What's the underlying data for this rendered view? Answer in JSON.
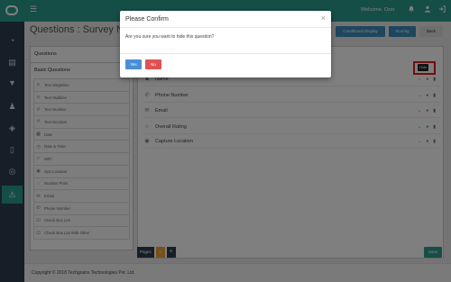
{
  "header": {
    "welcome": "Welcome, Ozer",
    "menu_icon": "☰",
    "icons": [
      "bell-icon",
      "user-icon",
      "logout-icon"
    ]
  },
  "sidebar": {
    "icons": [
      {
        "name": "dashboard-icon",
        "glyph": "◔"
      },
      {
        "name": "book-icon",
        "glyph": "▤"
      },
      {
        "name": "filter-icon",
        "glyph": "▼"
      },
      {
        "name": "users-icon",
        "glyph": "♟"
      },
      {
        "name": "layers-icon",
        "glyph": "◈"
      },
      {
        "name": "mobile-icon",
        "glyph": "▯"
      },
      {
        "name": "support-icon",
        "glyph": "◎"
      },
      {
        "name": "warning-icon",
        "glyph": "⚠",
        "active": true
      }
    ]
  },
  "page": {
    "title": "Questions : Survey Name",
    "buttons": {
      "conditional_display": "Conditional Display",
      "scoring": "Scoring",
      "back": "Back"
    }
  },
  "left_panel": {
    "tab": "Questions",
    "section_title": "Basic Questions",
    "items": [
      {
        "label": "Text Singleline",
        "icon": "≡"
      },
      {
        "label": "Text Multiline",
        "icon": "≡"
      },
      {
        "label": "Text Number",
        "icon": "#"
      },
      {
        "label": "Text Decimal",
        "icon": "#"
      },
      {
        "label": "Date",
        "icon": "▦"
      },
      {
        "label": "Date & Time",
        "icon": "◷"
      },
      {
        "label": "WiFi",
        "icon": "≈"
      },
      {
        "label": "Gps Location",
        "icon": "◉"
      },
      {
        "label": "Number Point",
        "icon": "◌"
      },
      {
        "label": "Email",
        "icon": "✉"
      },
      {
        "label": "Phone Number",
        "icon": "✆"
      },
      {
        "label": "Check Box List",
        "icon": "☑"
      },
      {
        "label": "Check Box List With Other",
        "icon": "☑"
      }
    ]
  },
  "questions": [
    {
      "label": "Name",
      "icon": "♟",
      "hidden": true
    },
    {
      "label": "Phone Number",
      "icon": "✆",
      "hidden": false
    },
    {
      "label": "Email",
      "icon": "✉",
      "hidden": false
    },
    {
      "label": "Overall Rating",
      "icon": "☆",
      "hidden": false
    },
    {
      "label": "Capture Location",
      "icon": "◉",
      "hidden": false
    }
  ],
  "tooltip": "Hide",
  "pages": {
    "label": "Pages",
    "current": "1",
    "add": "+"
  },
  "save_label": "Save",
  "footer": {
    "copyright": "Copyright © 2018 Techgrains Technologies Pvt. Ltd."
  },
  "modal": {
    "title": "Please Confirm",
    "close": "×",
    "message": "Are you sure you want to hide this question?",
    "yes": "Yes",
    "no": "No"
  }
}
